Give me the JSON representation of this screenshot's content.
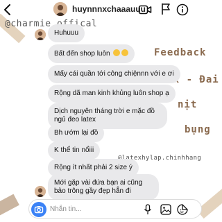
{
  "header": {
    "username": "huynnnxchaaauuu"
  },
  "watermarks": {
    "top": "@charmie.offical",
    "feedback": "Feedback",
    "latex": "Latex - Đai",
    "nit": "nịt",
    "bung": "bụng",
    "bottom": "@latexhylap.chinhhang"
  },
  "messages": [
    {
      "text": "Huhuuu"
    },
    {
      "text": "Bất đến shop luôn"
    },
    {
      "text": "Mấy cái quần tới công chiệnnn với e ơi"
    },
    {
      "text": "Rộng dã man kinh khủng luôn shop ạ"
    },
    {
      "text": "Dịch nguyên tháng trời e mặc đồ ngủ đeo latex"
    },
    {
      "text": "Bh ướm lại đồ"
    },
    {
      "text": "K thể tin nổiii"
    },
    {
      "text": "Rộng ít nhất phải 2 size ý"
    },
    {
      "text": "Mới gặp vài đứa bạn ai cũng bảo trông gầy đẹp hẳn đi"
    }
  ],
  "composer": {
    "placeholder": "Nhắn tin..."
  }
}
